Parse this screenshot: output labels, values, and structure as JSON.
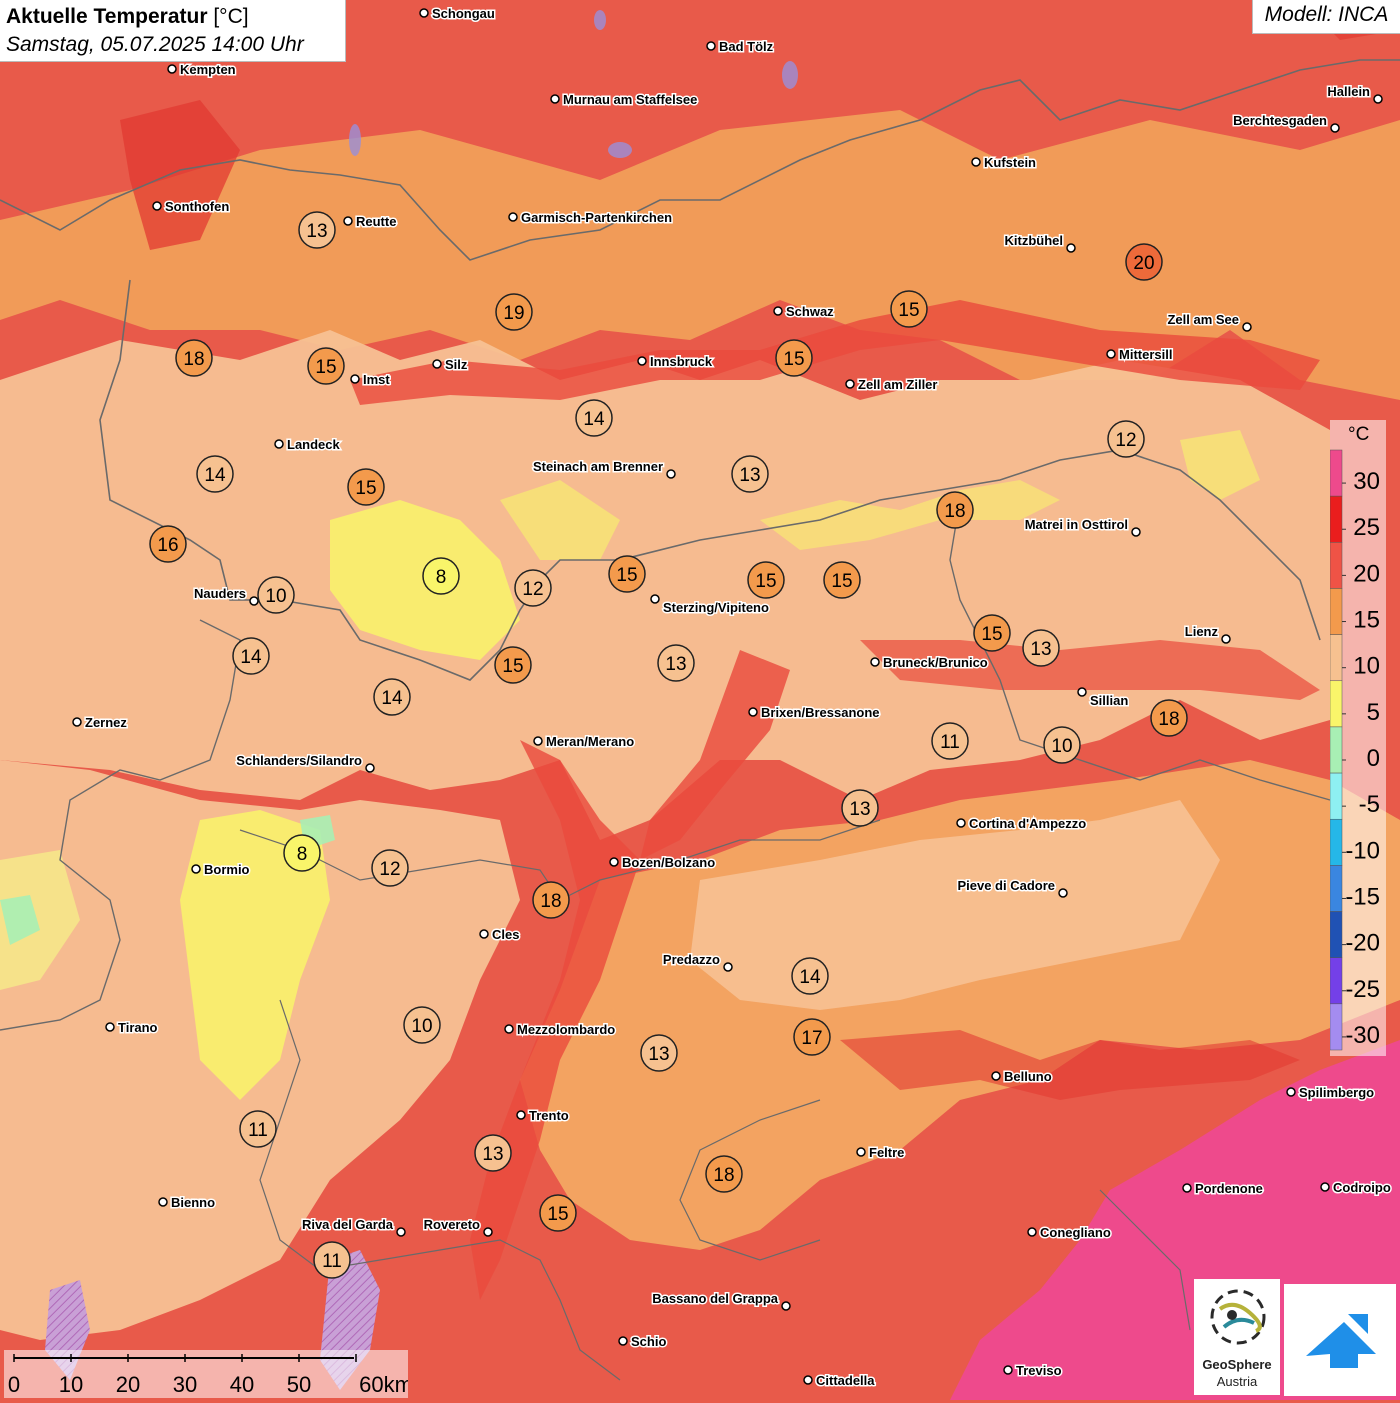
{
  "header": {
    "title_bold": "Aktuelle Temperatur",
    "title_unit": "[°C]",
    "subtitle": "Samstag, 05.07.2025 14:00 Uhr",
    "model": "Modell: INCA"
  },
  "legend": {
    "unit": "°C",
    "levels": [
      {
        "label": "30",
        "color": "#ee4a8c"
      },
      {
        "label": "25",
        "color": "#ea1d1d"
      },
      {
        "label": "20",
        "color": "#ef5346"
      },
      {
        "label": "15",
        "color": "#f39a4c"
      },
      {
        "label": "10",
        "color": "#f6c190"
      },
      {
        "label": "5",
        "color": "#f9f56a"
      },
      {
        "label": "0",
        "color": "#a8efb4"
      },
      {
        "label": "-5",
        "color": "#8ef0f2"
      },
      {
        "label": "-10",
        "color": "#25b7e8"
      },
      {
        "label": "-15",
        "color": "#3a86e0"
      },
      {
        "label": "-20",
        "color": "#2052b4"
      },
      {
        "label": "-25",
        "color": "#7440e8"
      },
      {
        "label": "-30",
        "color": "#a48cf0"
      }
    ]
  },
  "scale": {
    "ticks": [
      "0",
      "10",
      "20",
      "30",
      "40",
      "50",
      "60km"
    ]
  },
  "logos": {
    "geosphere_line1": "GeoSphere",
    "geosphere_line2": "Austria"
  },
  "towns": [
    "Schongau",
    "Bad Tölz",
    "Kempten",
    "Murnau am Staffelsee",
    "Hallein",
    "Berchtesgaden",
    "Kufstein",
    "Sonthofen",
    "Reutte",
    "Garmisch-Partenkirchen",
    "Kitzbühel",
    "Schwaz",
    "Zell am See",
    "Innsbruck",
    "Mittersill",
    "Imst",
    "Silz",
    "Zell am Ziller",
    "Landeck",
    "Steinach am Brenner",
    "Matrei in Osttirol",
    "Nauders",
    "Sterzing/Vipiteno",
    "Lienz",
    "Bruneck/Brunico",
    "Sillian",
    "Zernez",
    "Brixen/Bressanone",
    "Meran/Merano",
    "Schlanders/Silandro",
    "Cortina d'Ampezzo",
    "Bozen/Bolzano",
    "Bormio",
    "Pieve di Cadore",
    "Cles",
    "Predazzo",
    "Tirano",
    "Mezzolombardo",
    "Belluno",
    "Spilimbergo",
    "Trento",
    "Feltre",
    "Pordenone",
    "Codroipo",
    "Bienno",
    "Riva del Garda",
    "Rovereto",
    "Conegliano",
    "Bassano del Grappa",
    "Schio",
    "Treviso",
    "Cittadella"
  ],
  "station_values": [
    "13",
    "19",
    "20",
    "15",
    "18",
    "15",
    "15",
    "12",
    "14",
    "14",
    "13",
    "15",
    "18",
    "16",
    "8",
    "12",
    "15",
    "15",
    "15",
    "10",
    "14",
    "15",
    "13",
    "13",
    "15",
    "14",
    "18",
    "11",
    "10",
    "13",
    "8",
    "12",
    "18",
    "14",
    "10",
    "13",
    "17",
    "11",
    "13",
    "18",
    "15",
    "11"
  ]
}
